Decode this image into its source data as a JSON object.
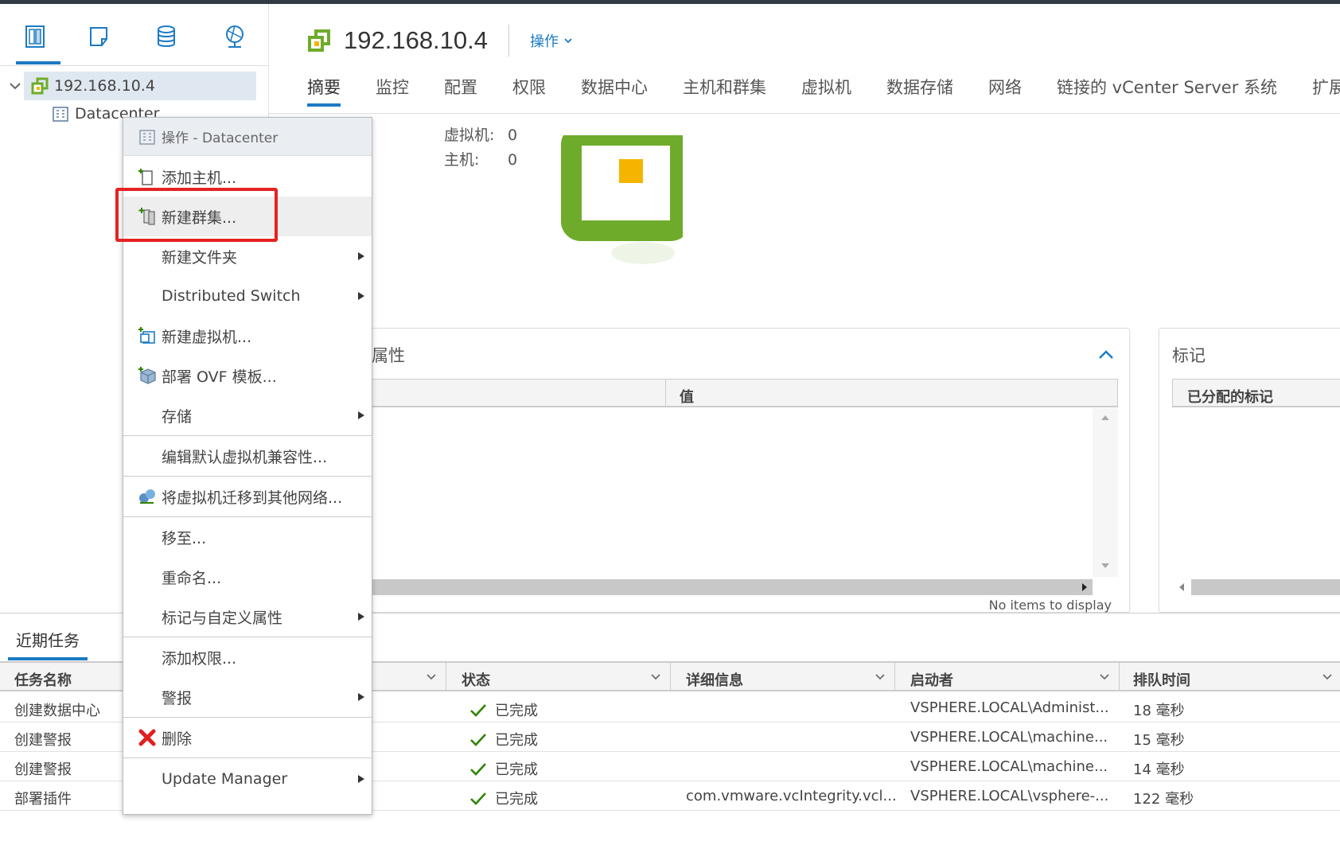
{
  "window": {
    "topbar_color": "#313c47",
    "accent": "#1b7ac4"
  },
  "navigator": {
    "icons": [
      "hosts-clusters-icon",
      "vms-templates-icon",
      "storage-icon",
      "networking-icon"
    ],
    "tree": [
      {
        "label": "192.168.10.4",
        "icon": "vcenter-icon"
      },
      {
        "label": "Datacenter",
        "icon": "datacenter-icon"
      }
    ]
  },
  "header": {
    "title": "192.168.10.4",
    "actions_label": "操作"
  },
  "tabs": [
    "摘要",
    "监控",
    "配置",
    "权限",
    "数据中心",
    "主机和群集",
    "虚拟机",
    "数据存储",
    "网络",
    "链接的 vCenter Server 系统",
    "扩展"
  ],
  "summary": {
    "vms_label": "虚拟机:",
    "vms_value": "0",
    "hosts_label": "主机:",
    "hosts_value": "0"
  },
  "attributes_panel": {
    "title": "属性",
    "col_value": "值",
    "empty_text": "No items to display"
  },
  "tags_panel": {
    "title": "标记",
    "col_assigned": "已分配的标记"
  },
  "context_menu": {
    "header": "操作 - Datacenter",
    "items": [
      {
        "label": "添加主机...",
        "icon": "add-host-icon",
        "submenu": false
      },
      {
        "label": "新建群集...",
        "icon": "new-cluster-icon",
        "submenu": false
      },
      {
        "label": "新建文件夹",
        "icon": "",
        "submenu": true
      },
      {
        "label": "Distributed Switch",
        "icon": "",
        "submenu": true
      },
      {
        "label": "新建虚拟机...",
        "icon": "new-vm-icon",
        "submenu": false
      },
      {
        "label": "部署 OVF 模板...",
        "icon": "deploy-ovf-icon",
        "submenu": false
      },
      {
        "label": "存储",
        "icon": "",
        "submenu": true
      },
      {
        "label": "编辑默认虚拟机兼容性...",
        "icon": "",
        "submenu": false
      },
      {
        "label": "将虚拟机迁移到其他网络...",
        "icon": "migrate-network-icon",
        "submenu": false
      },
      {
        "label": "移至...",
        "icon": "",
        "submenu": false
      },
      {
        "label": "重命名...",
        "icon": "",
        "submenu": false
      },
      {
        "label": "标记与自定义属性",
        "icon": "",
        "submenu": true
      },
      {
        "label": "添加权限...",
        "icon": "",
        "submenu": false
      },
      {
        "label": "警报",
        "icon": "",
        "submenu": true
      },
      {
        "label": "删除",
        "icon": "delete-icon",
        "submenu": false
      },
      {
        "label": "Update Manager",
        "icon": "",
        "submenu": true
      }
    ]
  },
  "recent_tasks": {
    "tab_label": "近期任务",
    "columns": [
      "任务名称",
      "状态",
      "详细信息",
      "启动者",
      "排队时间"
    ],
    "rows": [
      {
        "name": "创建数据中心",
        "status": "已完成",
        "details": "",
        "initiator": "VSPHERE.LOCAL\\Administ...",
        "queued": "18 毫秒"
      },
      {
        "name": "创建警报",
        "status": "已完成",
        "details": "",
        "initiator": "VSPHERE.LOCAL\\machine...",
        "queued": "15 毫秒"
      },
      {
        "name": "创建警报",
        "status": "已完成",
        "details": "",
        "initiator": "VSPHERE.LOCAL\\machine...",
        "queued": "14 毫秒"
      },
      {
        "name": "部署插件",
        "status": "已完成",
        "details": "com.vmware.vcIntegrity.vcl...",
        "initiator": "VSPHERE.LOCAL\\vsphere-...",
        "queued": "122 毫秒"
      }
    ]
  }
}
